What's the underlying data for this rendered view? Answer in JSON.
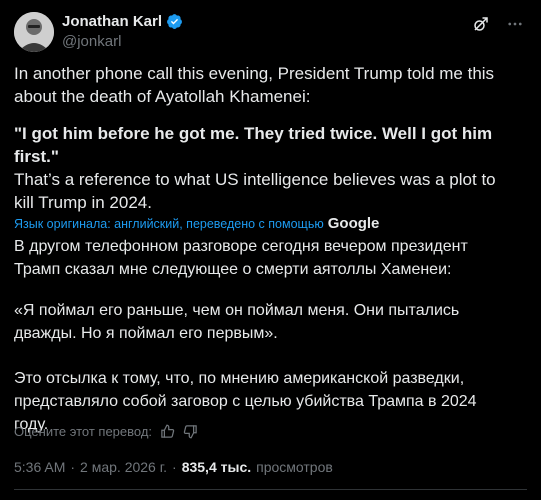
{
  "author": {
    "name": "Jonathan Karl",
    "handle": "@jonkarl",
    "verified_color": "#1d9bf0"
  },
  "top_icons": [
    "grok-icon",
    "more-icon"
  ],
  "tweet": {
    "paragraph1": "In another phone call this evening, President Trump told me this about the death of Ayatollah Khamenei:",
    "paragraph2": "\"I got him before he got me. They tried twice. Well I got him first.\"",
    "paragraph3": "That’s a reference to what US intelligence believes was a plot to kill Trump in 2024."
  },
  "translation": {
    "label": "Язык оригинала: английский, переведено с помощью",
    "provider": "Google",
    "paragraph1": "В другом телефонном разговоре сегодня вечером президент Трамп сказал мне следующее о смерти аятоллы Хаменеи:",
    "paragraph2": "«Я поймал его раньше, чем он поймал меня. Они пытались дважды. Но я поймал его первым».",
    "paragraph3": "Это отсылка к тому, что, по мнению американской разведки, представляло собой заговор с целью убийства Трампа в 2024 году."
  },
  "rate": {
    "label": "Оцените этот перевод:"
  },
  "meta": {
    "time": "5:36 AM",
    "sep1": "·",
    "date": "2 мар. 2026 г.",
    "sep2": "·",
    "views_count": "835,4 тыс.",
    "views_label": "просмотров"
  },
  "colors": {
    "background": "#000000",
    "text": "#e7e9ea",
    "muted": "#71767b",
    "accent": "#1d9bf0"
  }
}
